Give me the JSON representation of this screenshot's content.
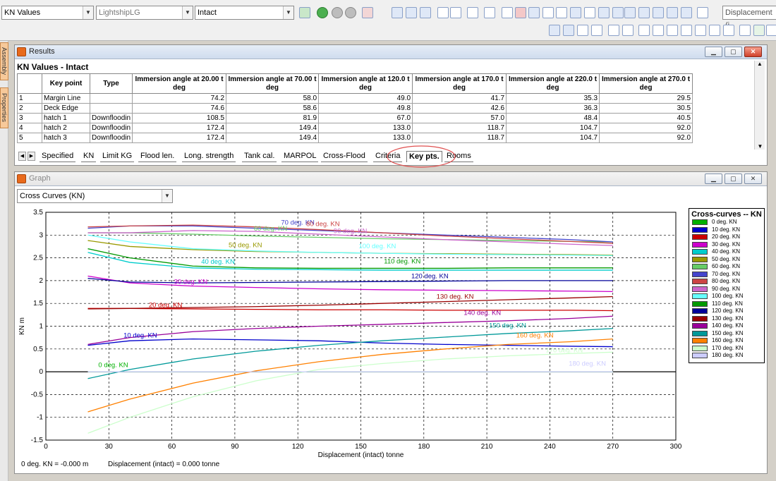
{
  "toolbar": {
    "kn_select": "KN Values",
    "vessel_select": "LightshipLG",
    "condition_select": "Intact",
    "displacement_field": "Displacement (i"
  },
  "sidetabs": [
    "Assembly",
    "Properties"
  ],
  "results": {
    "title": "Results",
    "heading": "KN Values - Intact",
    "columns": [
      "Key point",
      "Type",
      "Immersion angle at 20.00 t deg",
      "Immersion angle at 70.00 t deg",
      "Immersion angle at 120.0 t deg",
      "Immersion angle at 170.0 t deg",
      "Immersion angle at 220.0 t deg",
      "Immersion angle at 270.0 t deg"
    ],
    "rows": [
      {
        "n": "1",
        "key": "Margin Line",
        "type": "",
        "v": [
          "74.2",
          "58.0",
          "49.0",
          "41.7",
          "35.3",
          "29.5"
        ]
      },
      {
        "n": "2",
        "key": "Deck Edge",
        "type": "",
        "v": [
          "74.6",
          "58.6",
          "49.8",
          "42.6",
          "36.3",
          "30.5"
        ]
      },
      {
        "n": "3",
        "key": "hatch 1",
        "type": "Downfloodin",
        "v": [
          "108.5",
          "81.9",
          "67.0",
          "57.0",
          "48.4",
          "40.5"
        ]
      },
      {
        "n": "4",
        "key": "hatch 2",
        "type": "Downfloodin",
        "v": [
          "172.4",
          "149.4",
          "133.0",
          "118.7",
          "104.7",
          "92.0"
        ]
      },
      {
        "n": "5",
        "key": "hatch 3",
        "type": "Downfloodin",
        "v": [
          "172.4",
          "149.4",
          "133.0",
          "118.7",
          "104.7",
          "92.0"
        ]
      }
    ],
    "tabs": [
      "Specified",
      "KN",
      "Limit KG",
      "Flood len.",
      "Long. strength",
      "Tank cal.",
      "MARPOL",
      "Cross-Flood",
      "Criteria",
      "Key pts.",
      "Rooms"
    ],
    "active_tab": "Key pts."
  },
  "graph": {
    "title": "Graph",
    "select": "Cross Curves (KN)"
  },
  "chart_data": {
    "type": "line",
    "xlabel": "Displacement (intact)  tonne",
    "ylabel": "KN  m",
    "xlim": [
      0,
      300
    ],
    "ylim": [
      -1.5,
      3.5
    ],
    "xticks": [
      "0",
      "30",
      "60",
      "90",
      "120",
      "150",
      "180",
      "210",
      "240",
      "270",
      "300"
    ],
    "yticks": [
      "3.5",
      "3",
      "2.5",
      "2",
      "1.5",
      "1",
      "0.5",
      "0",
      "-0.5",
      "-1",
      "-1.5"
    ],
    "grid": true,
    "legend_title": "Cross-curves -- KN",
    "legend_position": "right",
    "x": [
      20,
      40,
      70,
      100,
      130,
      160,
      190,
      220,
      250,
      270
    ],
    "series": [
      {
        "name": "0 deg.  KN",
        "color": "#00b000",
        "values": [
          0,
          0,
          0,
          0,
          0,
          0,
          0,
          0,
          0,
          0
        ]
      },
      {
        "name": "10 deg.  KN",
        "color": "#0000cc",
        "values": [
          0.58,
          0.68,
          0.72,
          0.7,
          0.68,
          0.63,
          0.6,
          0.58,
          0.56,
          0.55
        ]
      },
      {
        "name": "20 deg.  KN",
        "color": "#cc0000",
        "values": [
          1.39,
          1.39,
          1.38,
          1.37,
          1.36,
          1.36,
          1.35,
          1.35,
          1.35,
          1.34
        ]
      },
      {
        "name": "30 deg.  KN",
        "color": "#cc00cc",
        "values": [
          2.1,
          1.95,
          1.88,
          1.85,
          1.82,
          1.8,
          1.79,
          1.78,
          1.77,
          1.76
        ]
      },
      {
        "name": "40 deg.  KN",
        "color": "#00cccc",
        "values": [
          2.62,
          2.4,
          2.28,
          2.25,
          2.24,
          2.23,
          2.23,
          2.23,
          2.23,
          2.23
        ]
      },
      {
        "name": "50 deg.  KN",
        "color": "#999900",
        "values": [
          2.88,
          2.75,
          2.68,
          2.64,
          2.62,
          2.6,
          2.59,
          2.58,
          2.57,
          2.56
        ]
      },
      {
        "name": "60 deg.  KN",
        "color": "#66cc66",
        "values": [
          3.05,
          3.05,
          3.02,
          2.98,
          2.95,
          2.92,
          2.9,
          2.88,
          2.86,
          2.85
        ]
      },
      {
        "name": "70 deg.  KN",
        "color": "#4444cc",
        "values": [
          3.15,
          3.2,
          3.2,
          3.15,
          3.1,
          3.05,
          3.0,
          2.95,
          2.9,
          2.85
        ]
      },
      {
        "name": "80 deg.  KN",
        "color": "#cc4444",
        "values": [
          3.18,
          3.2,
          3.22,
          3.18,
          3.12,
          3.05,
          2.98,
          2.92,
          2.86,
          2.82
        ]
      },
      {
        "name": "90 deg.  KN",
        "color": "#cc66cc",
        "values": [
          3.05,
          3.05,
          3.1,
          3.08,
          3.02,
          2.96,
          2.9,
          2.85,
          2.8,
          2.77
        ]
      },
      {
        "name": "100 deg.  KN",
        "color": "#66ffff",
        "values": [
          3.0,
          2.85,
          2.7,
          2.65,
          2.62,
          2.6,
          2.58,
          2.57,
          2.56,
          2.55
        ]
      },
      {
        "name": "110 deg.  KN",
        "color": "#009900",
        "values": [
          2.7,
          2.5,
          2.32,
          2.28,
          2.27,
          2.27,
          2.27,
          2.28,
          2.28,
          2.28
        ]
      },
      {
        "name": "120 deg.  KN",
        "color": "#000099",
        "values": [
          2.05,
          1.97,
          1.95,
          1.96,
          1.97,
          1.98,
          1.99,
          2.0,
          2.0,
          2.0
        ]
      },
      {
        "name": "130 deg.  KN",
        "color": "#990000",
        "values": [
          1.38,
          1.39,
          1.41,
          1.43,
          1.46,
          1.5,
          1.54,
          1.58,
          1.62,
          1.65
        ]
      },
      {
        "name": "140 deg.  KN",
        "color": "#990099",
        "values": [
          0.6,
          0.75,
          0.88,
          0.95,
          1.0,
          1.04,
          1.08,
          1.12,
          1.17,
          1.22
        ]
      },
      {
        "name": "150 deg.  KN",
        "color": "#009999",
        "values": [
          -0.15,
          0.05,
          0.28,
          0.45,
          0.58,
          0.68,
          0.76,
          0.84,
          0.9,
          0.95
        ]
      },
      {
        "name": "160 deg.  KN",
        "color": "#ff8000",
        "values": [
          -0.88,
          -0.6,
          -0.25,
          0.02,
          0.22,
          0.38,
          0.5,
          0.6,
          0.66,
          0.72
        ]
      },
      {
        "name": "170 deg.  KN",
        "color": "#ccffcc",
        "values": [
          -1.35,
          -1.0,
          -0.55,
          -0.2,
          0.05,
          0.18,
          0.28,
          0.35,
          0.4,
          0.43
        ]
      },
      {
        "name": "180 deg.  KN",
        "color": "#ccccff",
        "values": [
          0,
          0,
          0,
          0,
          0,
          0,
          0,
          0,
          0,
          0
        ]
      }
    ],
    "curve_labels": [
      {
        "text": "0 deg.  KN",
        "color": "#00b000",
        "x": 25,
        "y": 0.1
      },
      {
        "text": "10 deg.  KN",
        "color": "#0000cc",
        "x": 37,
        "y": 0.75
      },
      {
        "text": "20 deg.  KN",
        "color": "#cc0000",
        "x": 49,
        "y": 1.42
      },
      {
        "text": "30 deg.  KN",
        "color": "#cc00cc",
        "x": 61,
        "y": 1.93
      },
      {
        "text": "40 deg.  KN",
        "color": "#00cccc",
        "x": 74,
        "y": 2.37
      },
      {
        "text": "50 deg.  KN",
        "color": "#999900",
        "x": 87,
        "y": 2.73
      },
      {
        "text": "60 deg.  KN",
        "color": "#66cc66",
        "x": 99,
        "y": 3.1
      },
      {
        "text": "70 deg.  KN",
        "color": "#4444cc",
        "x": 112,
        "y": 3.23
      },
      {
        "text": "80 deg.  KN",
        "color": "#cc4444",
        "x": 124,
        "y": 3.2
      },
      {
        "text": "90 deg.  KN",
        "color": "#cc66cc",
        "x": 137,
        "y": 3.04
      },
      {
        "text": "100 deg.  KN",
        "color": "#66ffff",
        "x": 149,
        "y": 2.71
      },
      {
        "text": "110 deg.  KN",
        "color": "#009900",
        "x": 161,
        "y": 2.38
      },
      {
        "text": "120 deg.  KN",
        "color": "#000099",
        "x": 174,
        "y": 2.05
      },
      {
        "text": "130 deg.  KN",
        "color": "#990000",
        "x": 186,
        "y": 1.6
      },
      {
        "text": "140 deg.  KN",
        "color": "#990099",
        "x": 199,
        "y": 1.25
      },
      {
        "text": "150 deg.  KN",
        "color": "#009999",
        "x": 211,
        "y": 0.97
      },
      {
        "text": "160 deg.  KN",
        "color": "#ff8000",
        "x": 224,
        "y": 0.75
      },
      {
        "text": "170 deg.  KN",
        "color": "#ccffcc",
        "x": 238,
        "y": 0.43
      },
      {
        "text": "180 deg.  KN",
        "color": "#ccccff",
        "x": 249,
        "y": 0.13
      }
    ]
  },
  "status": {
    "readout": "0 deg.  KN = -0.000 m",
    "displacement": "Displacement (intact) =  0.000 tonne"
  }
}
